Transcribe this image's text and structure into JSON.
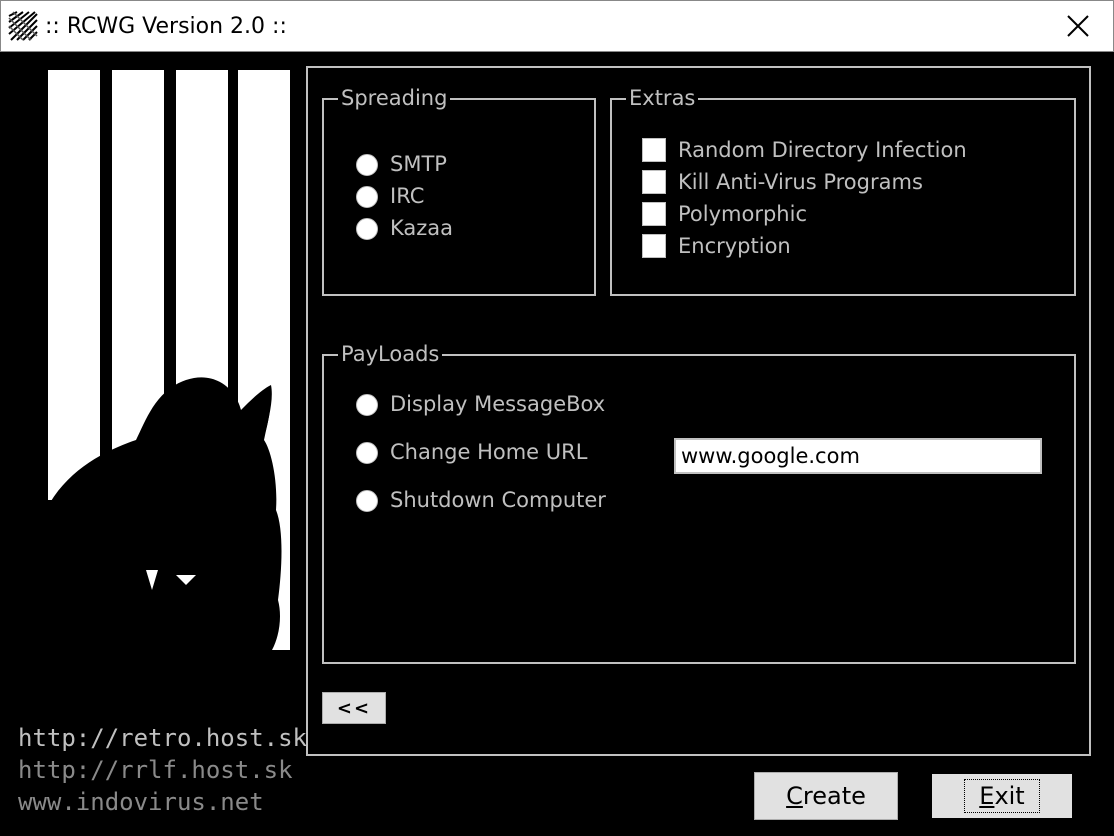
{
  "window": {
    "title": ":: RCWG Version 2.0 ::"
  },
  "spreading": {
    "legend": "Spreading",
    "options": [
      "SMTP",
      "IRC",
      "Kazaa"
    ]
  },
  "extras": {
    "legend": "Extras",
    "options": [
      "Random Directory Infection",
      "Kill Anti-Virus Programs",
      "Polymorphic",
      "Encryption"
    ]
  },
  "payloads": {
    "legend": "PayLoads",
    "options": [
      "Display MessageBox",
      "Change Home URL",
      "Shutdown Computer"
    ],
    "url_value": "www.google.com"
  },
  "links": [
    "http://retro.host.sk",
    "http://rrlf.host.sk",
    "www.indovirus.net"
  ],
  "buttons": {
    "back": "<<",
    "create_accel": "C",
    "create_rest": "reate",
    "exit_accel": "E",
    "exit_rest": "xit"
  },
  "colors": {
    "background": "#000000",
    "text": "#c0c0c0",
    "titlebar": "#ffffff"
  }
}
